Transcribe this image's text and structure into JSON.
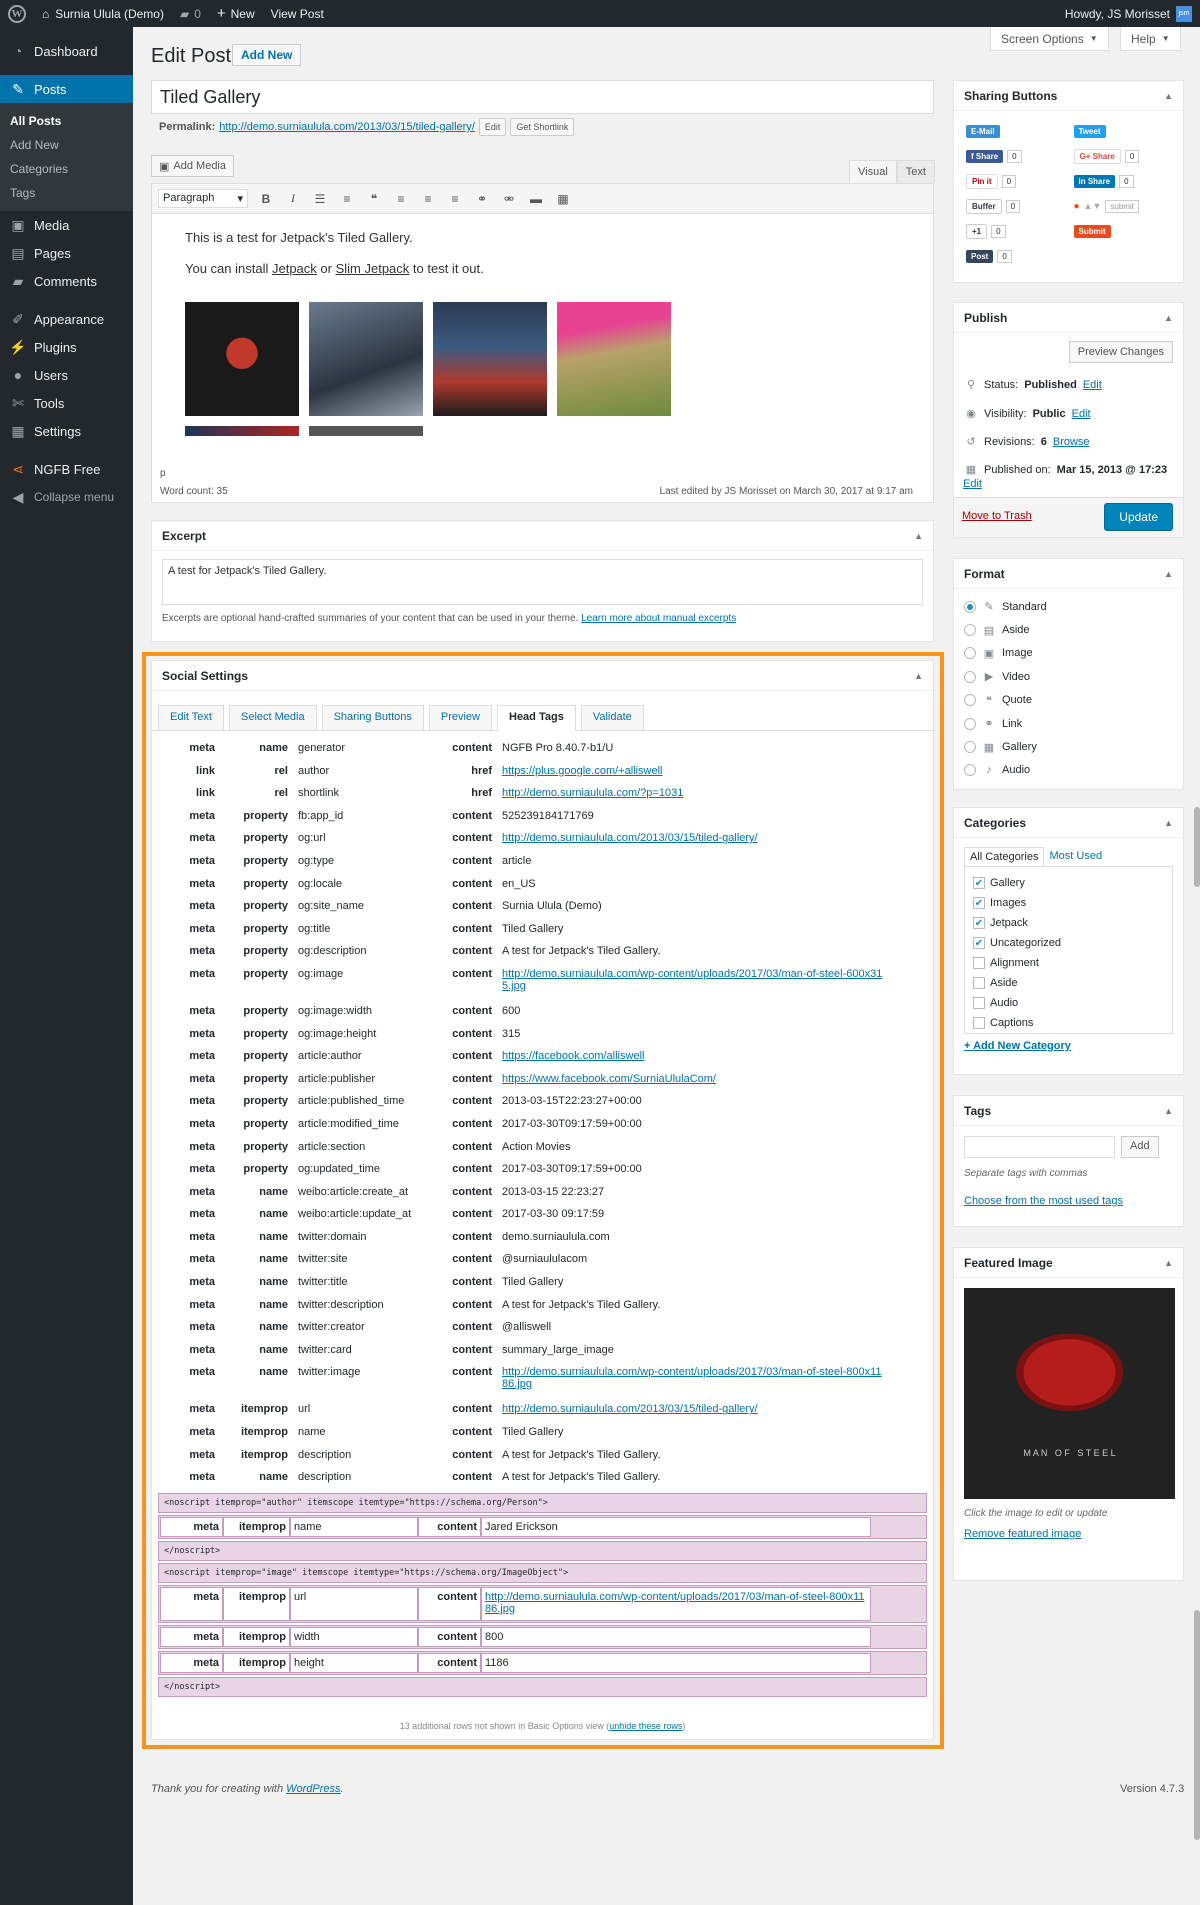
{
  "adminbar": {
    "site_name": "Surnia Ulula (Demo)",
    "comments_count": "0",
    "new_label": "New",
    "view_post_label": "View Post",
    "howdy": "Howdy, JS Morisset",
    "avatar_text": "jsm"
  },
  "sidebar": {
    "dashboard": "Dashboard",
    "posts": "Posts",
    "posts_sub": [
      "All Posts",
      "Add New",
      "Categories",
      "Tags"
    ],
    "media": "Media",
    "pages": "Pages",
    "comments": "Comments",
    "appearance": "Appearance",
    "plugins": "Plugins",
    "users": "Users",
    "tools": "Tools",
    "settings": "Settings",
    "ngfb": "NGFB Free",
    "collapse": "Collapse menu"
  },
  "header": {
    "title": "Edit Post",
    "add_new": "Add New",
    "screen_options": "Screen Options",
    "help": "Help"
  },
  "post": {
    "title": "Tiled Gallery",
    "permalink_label": "Permalink:",
    "permalink_url": "http://demo.surniaulula.com/2013/03/15/tiled-gallery/",
    "edit_btn": "Edit",
    "shortlink_btn": "Get Shortlink",
    "add_media": "Add Media",
    "tab_visual": "Visual",
    "tab_text": "Text",
    "format_select": "Paragraph",
    "body_line1": "This is a test for Jetpack's Tiled Gallery.",
    "body_line2_pre": "You can install ",
    "body_link1": "Jetpack",
    "body_line2_mid": " or ",
    "body_link2": "Slim Jetpack",
    "body_line2_post": " to test it out.",
    "path": "p",
    "word_count": "Word count: 35",
    "last_edited": "Last edited by JS Morisset on March 30, 2017 at 9:17 am"
  },
  "excerpt": {
    "heading": "Excerpt",
    "text": "A test for Jetpack's Tiled Gallery.",
    "note": "Excerpts are optional hand-crafted summaries of your content that can be used in your theme.",
    "note_link": "Learn more about manual excerpts"
  },
  "social": {
    "heading": "Social Settings",
    "tabs": [
      "Edit Text",
      "Select Media",
      "Sharing Buttons",
      "Preview",
      "Head Tags",
      "Validate"
    ],
    "active_tab": "Head Tags",
    "rows": [
      {
        "tag": "meta",
        "attr": "name",
        "name": "generator",
        "key": "content",
        "value": "NGFB Pro 8.40.7-b1/U",
        "link": false
      },
      {
        "tag": "link",
        "attr": "rel",
        "name": "author",
        "key": "href",
        "value": "https://plus.google.com/+alliswell",
        "link": true
      },
      {
        "tag": "link",
        "attr": "rel",
        "name": "shortlink",
        "key": "href",
        "value": "http://demo.surniaulula.com/?p=1031",
        "link": true
      },
      {
        "tag": "meta",
        "attr": "property",
        "name": "fb:app_id",
        "key": "content",
        "value": "525239184171769",
        "link": false
      },
      {
        "tag": "meta",
        "attr": "property",
        "name": "og:url",
        "key": "content",
        "value": "http://demo.surniaulula.com/2013/03/15/tiled-gallery/",
        "link": true
      },
      {
        "tag": "meta",
        "attr": "property",
        "name": "og:type",
        "key": "content",
        "value": "article",
        "link": false
      },
      {
        "tag": "meta",
        "attr": "property",
        "name": "og:locale",
        "key": "content",
        "value": "en_US",
        "link": false
      },
      {
        "tag": "meta",
        "attr": "property",
        "name": "og:site_name",
        "key": "content",
        "value": "Surnia Ulula (Demo)",
        "link": false
      },
      {
        "tag": "meta",
        "attr": "property",
        "name": "og:title",
        "key": "content",
        "value": "Tiled Gallery",
        "link": false
      },
      {
        "tag": "meta",
        "attr": "property",
        "name": "og:description",
        "key": "content",
        "value": "A test for Jetpack's Tiled Gallery.",
        "link": false
      },
      {
        "tag": "meta",
        "attr": "property",
        "name": "og:image",
        "key": "content",
        "value": "http://demo.surniaulula.com/wp-content/uploads/2017/03/man-of-steel-600x315.jpg",
        "link": true,
        "tall": true
      },
      {
        "tag": "meta",
        "attr": "property",
        "name": "og:image:width",
        "key": "content",
        "value": "600",
        "link": false
      },
      {
        "tag": "meta",
        "attr": "property",
        "name": "og:image:height",
        "key": "content",
        "value": "315",
        "link": false
      },
      {
        "tag": "meta",
        "attr": "property",
        "name": "article:author",
        "key": "content",
        "value": "https://facebook.com/alliswell",
        "link": true
      },
      {
        "tag": "meta",
        "attr": "property",
        "name": "article:publisher",
        "key": "content",
        "value": "https://www.facebook.com/SurniaUlulaCom/",
        "link": true
      },
      {
        "tag": "meta",
        "attr": "property",
        "name": "article:published_time",
        "key": "content",
        "value": "2013-03-15T22:23:27+00:00",
        "link": false
      },
      {
        "tag": "meta",
        "attr": "property",
        "name": "article:modified_time",
        "key": "content",
        "value": "2017-03-30T09:17:59+00:00",
        "link": false
      },
      {
        "tag": "meta",
        "attr": "property",
        "name": "article:section",
        "key": "content",
        "value": "Action Movies",
        "link": false
      },
      {
        "tag": "meta",
        "attr": "property",
        "name": "og:updated_time",
        "key": "content",
        "value": "2017-03-30T09:17:59+00:00",
        "link": false
      },
      {
        "tag": "meta",
        "attr": "name",
        "name": "weibo:article:create_at",
        "key": "content",
        "value": "2013-03-15 22:23:27",
        "link": false
      },
      {
        "tag": "meta",
        "attr": "name",
        "name": "weibo:article:update_at",
        "key": "content",
        "value": "2017-03-30 09:17:59",
        "link": false
      },
      {
        "tag": "meta",
        "attr": "name",
        "name": "twitter:domain",
        "key": "content",
        "value": "demo.surniaulula.com",
        "link": false
      },
      {
        "tag": "meta",
        "attr": "name",
        "name": "twitter:site",
        "key": "content",
        "value": "@surniaululacom",
        "link": false
      },
      {
        "tag": "meta",
        "attr": "name",
        "name": "twitter:title",
        "key": "content",
        "value": "Tiled Gallery",
        "link": false
      },
      {
        "tag": "meta",
        "attr": "name",
        "name": "twitter:description",
        "key": "content",
        "value": "A test for Jetpack's Tiled Gallery.",
        "link": false
      },
      {
        "tag": "meta",
        "attr": "name",
        "name": "twitter:creator",
        "key": "content",
        "value": "@alliswell",
        "link": false
      },
      {
        "tag": "meta",
        "attr": "name",
        "name": "twitter:card",
        "key": "content",
        "value": "summary_large_image",
        "link": false
      },
      {
        "tag": "meta",
        "attr": "name",
        "name": "twitter:image",
        "key": "content",
        "value": "http://demo.surniaulula.com/wp-content/uploads/2017/03/man-of-steel-800x1186.jpg",
        "link": true,
        "tall": true
      },
      {
        "tag": "meta",
        "attr": "itemprop",
        "name": "url",
        "key": "content",
        "value": "http://demo.surniaulula.com/2013/03/15/tiled-gallery/",
        "link": true
      },
      {
        "tag": "meta",
        "attr": "itemprop",
        "name": "name",
        "key": "content",
        "value": "Tiled Gallery",
        "link": false
      },
      {
        "tag": "meta",
        "attr": "itemprop",
        "name": "description",
        "key": "content",
        "value": "A test for Jetpack's Tiled Gallery.",
        "link": false
      },
      {
        "tag": "meta",
        "attr": "name",
        "name": "description",
        "key": "content",
        "value": "A test for Jetpack's Tiled Gallery.",
        "link": false
      }
    ],
    "noscript1_open": "<noscript itemprop=\"author\" itemscope itemtype=\"https://schema.org/Person\">",
    "noscript1_rows": [
      {
        "tag": "meta",
        "attr": "itemprop",
        "name": "name",
        "key": "content",
        "value": "Jared Erickson",
        "link": false
      }
    ],
    "noscript_close": "</noscript>",
    "noscript2_open": "<noscript itemprop=\"image\" itemscope itemtype=\"https://schema.org/ImageObject\">",
    "noscript2_rows": [
      {
        "tag": "meta",
        "attr": "itemprop",
        "name": "url",
        "key": "content",
        "value": "http://demo.surniaulula.com/wp-content/uploads/2017/03/man-of-steel-800x1186.jpg",
        "link": true,
        "tall": true
      },
      {
        "tag": "meta",
        "attr": "itemprop",
        "name": "width",
        "key": "content",
        "value": "800",
        "link": false
      },
      {
        "tag": "meta",
        "attr": "itemprop",
        "name": "height",
        "key": "content",
        "value": "1186",
        "link": false
      }
    ],
    "additional_text": "13 additional rows not shown in Basic Options view (",
    "additional_link": "unhide these rows",
    "additional_close": ")"
  },
  "footer": {
    "thanks_pre": "Thank you for creating with ",
    "thanks_link": "WordPress",
    "thanks_post": ".",
    "version": "Version 4.7.3"
  },
  "sharing": {
    "heading": "Sharing Buttons",
    "buttons": [
      {
        "label": "E-Mail",
        "color": "#3b8fd1",
        "count": ""
      },
      {
        "label": "Tweet",
        "color": "#1da1f2",
        "count": ""
      },
      {
        "label": "Share",
        "color": "#3b5998",
        "count": "0"
      },
      {
        "label": "G+ Share",
        "color": "#ffffff",
        "count": "0"
      },
      {
        "label": "Pin it",
        "color": "#ffffff",
        "count": "0"
      },
      {
        "label": "in Share",
        "color": "#0077b5",
        "count": "0"
      },
      {
        "label": "Buffer",
        "color": "#ffffff",
        "count": "0"
      },
      {
        "label": "submit",
        "color": "#ffffff",
        "count": ""
      },
      {
        "label": "+1",
        "color": "#ffffff",
        "count": "0"
      },
      {
        "label": "Submit",
        "color": "#ff4500",
        "count": ""
      },
      {
        "label": "Post",
        "color": "#35465c",
        "count": "0"
      }
    ]
  },
  "publish": {
    "heading": "Publish",
    "preview": "Preview Changes",
    "status_label": "Status:",
    "status_value": "Published",
    "visibility_label": "Visibility:",
    "visibility_value": "Public",
    "revisions_label": "Revisions:",
    "revisions_value": "6",
    "browse": "Browse",
    "published_label": "Published on:",
    "published_value": "Mar 15, 2013 @ 17:23",
    "edit": "Edit",
    "trash": "Move to Trash",
    "update": "Update"
  },
  "format": {
    "heading": "Format",
    "options": [
      "Standard",
      "Aside",
      "Image",
      "Video",
      "Quote",
      "Link",
      "Gallery",
      "Audio"
    ],
    "selected": "Standard"
  },
  "categories": {
    "heading": "Categories",
    "tab_all": "All Categories",
    "tab_used": "Most Used",
    "items": [
      {
        "name": "Gallery",
        "checked": true
      },
      {
        "name": "Images",
        "checked": true
      },
      {
        "name": "Jetpack",
        "checked": true
      },
      {
        "name": "Uncategorized",
        "checked": true
      },
      {
        "name": "Alignment",
        "checked": false
      },
      {
        "name": "Aside",
        "checked": false
      },
      {
        "name": "Audio",
        "checked": false
      },
      {
        "name": "Captions",
        "checked": false
      }
    ],
    "add_new": "+ Add New Category"
  },
  "tags": {
    "heading": "Tags",
    "add": "Add",
    "note": "Separate tags with commas",
    "choose": "Choose from the most used tags"
  },
  "featured": {
    "heading": "Featured Image",
    "image_caption": "M A N   O F   S T E E L",
    "note": "Click the image to edit or update",
    "remove": "Remove featured image"
  }
}
